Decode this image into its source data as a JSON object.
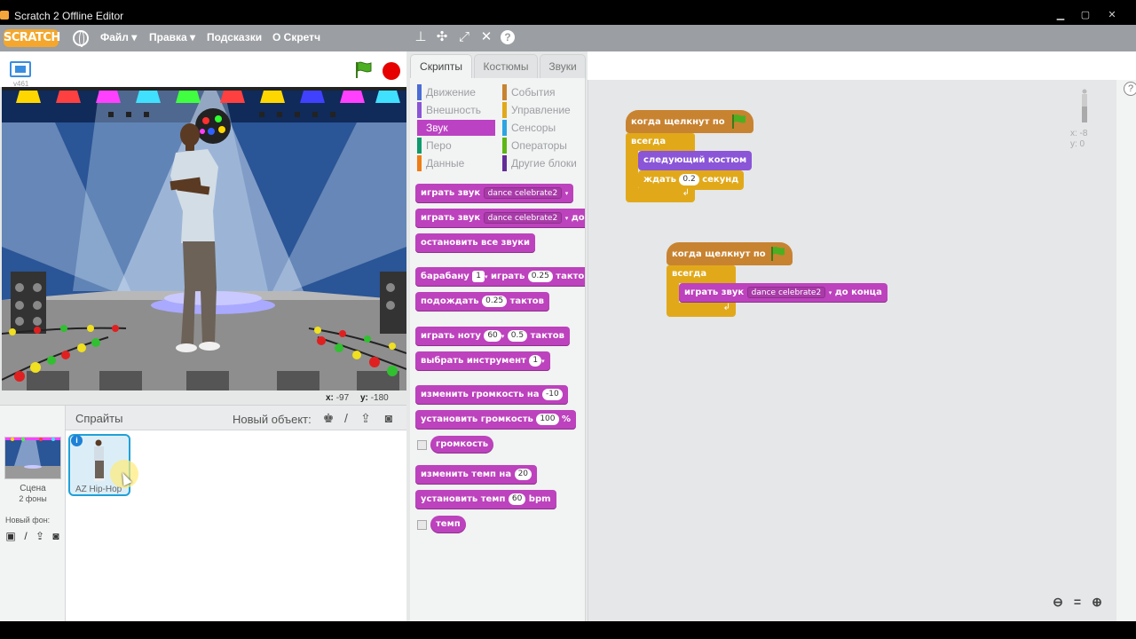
{
  "window": {
    "title": "Scratch 2 Offline Editor"
  },
  "menubar": {
    "logo": "SCRATCH",
    "menus": [
      "Файл ▾",
      "Правка ▾",
      "Подсказки",
      "О Скретч"
    ],
    "help_symbol": "?"
  },
  "stage": {
    "version": "v461",
    "mouse_x_label": "x:",
    "mouse_x": "-97",
    "mouse_y_label": "y:",
    "mouse_y": "-180"
  },
  "sprites": {
    "title": "Спрайты",
    "new_sprite_label": "Новый объект:",
    "scene_name": "Сцена",
    "scene_bg_count": "2 фоны",
    "new_background_label": "Новый фон:",
    "sprite_name": "AZ Hip-Hop",
    "info_symbol": "i"
  },
  "tabs": [
    "Скрипты",
    "Костюмы",
    "Звуки"
  ],
  "categories": [
    {
      "label": "Движение",
      "color": "#4a6cd4"
    },
    {
      "label": "События",
      "color": "#c88330"
    },
    {
      "label": "Внешность",
      "color": "#8a55d7"
    },
    {
      "label": "Управление",
      "color": "#e1a91a"
    },
    {
      "label": "Звук",
      "color": "#bb42c3"
    },
    {
      "label": "Сенсоры",
      "color": "#2ca5e2"
    },
    {
      "label": "Перо",
      "color": "#0e9a6c"
    },
    {
      "label": "Операторы",
      "color": "#5cb712"
    },
    {
      "label": "Данные",
      "color": "#ee7d16"
    },
    {
      "label": "Другие блоки",
      "color": "#632d99"
    }
  ],
  "palette": {
    "play_sound": "играть звук",
    "sound_name": "dance celebrate2",
    "play_sound_until": "играть звук",
    "until_done_cut": "до",
    "stop_all_sounds": "остановить все звуки",
    "drum_prefix": "барабану",
    "drum_value": "1",
    "drum_play": "играть",
    "drum_beats": "0.25",
    "drum_suffix": "такто",
    "rest_prefix": "подождать",
    "rest_beats": "0.25",
    "rest_suffix": "тактов",
    "note_prefix": "играть ноту",
    "note_value": "60",
    "note_beats": "0.5",
    "note_suffix": "тактов",
    "instrument_prefix": "выбрать инструмент",
    "instrument_value": "1",
    "change_volume": "изменить громкость на",
    "change_volume_value": "-10",
    "set_volume": "установить громкость",
    "set_volume_value": "100",
    "set_volume_unit": "%",
    "volume_reporter": "громкость",
    "change_tempo": "изменить темп на",
    "change_tempo_value": "20",
    "set_tempo": "установить темп",
    "set_tempo_value": "60",
    "set_tempo_unit": "bpm",
    "tempo_reporter": "темп"
  },
  "scripts": [
    {
      "hat": "когда щелкнут по",
      "loop": "всегда",
      "blocks": [
        {
          "text": "следующий костюм"
        },
        {
          "text": "ждать",
          "value": "0.2",
          "suffix": "секунд"
        }
      ],
      "loop_end": "↲"
    },
    {
      "hat": "когда щелкнут по",
      "loop": "всегда",
      "blocks": [
        {
          "text": "играть звук",
          "value": "dance celebrate2",
          "suffix": "до конца"
        }
      ],
      "loop_end": "↲"
    }
  ],
  "sprite_info": {
    "x": "x: -8",
    "y": "y: 0"
  },
  "zoom": {
    "out": "−",
    "reset": "=",
    "in": "+"
  },
  "colors": {
    "sound": "#bd42bd",
    "events": "#c88330",
    "control": "#e1a91a",
    "looks": "#8a55d7",
    "selected_sprite_border": "#1fa0d8"
  }
}
